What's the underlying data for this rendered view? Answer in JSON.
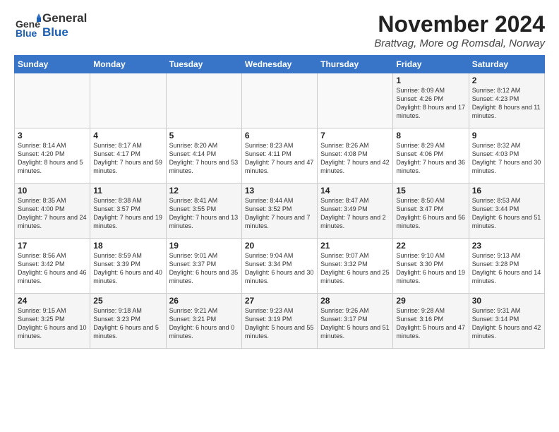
{
  "header": {
    "logo_general": "General",
    "logo_blue": "Blue",
    "title": "November 2024",
    "subtitle": "Brattvag, More og Romsdal, Norway"
  },
  "calendar": {
    "days_of_week": [
      "Sunday",
      "Monday",
      "Tuesday",
      "Wednesday",
      "Thursday",
      "Friday",
      "Saturday"
    ],
    "weeks": [
      [
        {
          "day": "",
          "info": ""
        },
        {
          "day": "",
          "info": ""
        },
        {
          "day": "",
          "info": ""
        },
        {
          "day": "",
          "info": ""
        },
        {
          "day": "",
          "info": ""
        },
        {
          "day": "1",
          "info": "Sunrise: 8:09 AM\nSunset: 4:26 PM\nDaylight: 8 hours and 17 minutes."
        },
        {
          "day": "2",
          "info": "Sunrise: 8:12 AM\nSunset: 4:23 PM\nDaylight: 8 hours and 11 minutes."
        }
      ],
      [
        {
          "day": "3",
          "info": "Sunrise: 8:14 AM\nSunset: 4:20 PM\nDaylight: 8 hours and 5 minutes."
        },
        {
          "day": "4",
          "info": "Sunrise: 8:17 AM\nSunset: 4:17 PM\nDaylight: 7 hours and 59 minutes."
        },
        {
          "day": "5",
          "info": "Sunrise: 8:20 AM\nSunset: 4:14 PM\nDaylight: 7 hours and 53 minutes."
        },
        {
          "day": "6",
          "info": "Sunrise: 8:23 AM\nSunset: 4:11 PM\nDaylight: 7 hours and 47 minutes."
        },
        {
          "day": "7",
          "info": "Sunrise: 8:26 AM\nSunset: 4:08 PM\nDaylight: 7 hours and 42 minutes."
        },
        {
          "day": "8",
          "info": "Sunrise: 8:29 AM\nSunset: 4:06 PM\nDaylight: 7 hours and 36 minutes."
        },
        {
          "day": "9",
          "info": "Sunrise: 8:32 AM\nSunset: 4:03 PM\nDaylight: 7 hours and 30 minutes."
        }
      ],
      [
        {
          "day": "10",
          "info": "Sunrise: 8:35 AM\nSunset: 4:00 PM\nDaylight: 7 hours and 24 minutes."
        },
        {
          "day": "11",
          "info": "Sunrise: 8:38 AM\nSunset: 3:57 PM\nDaylight: 7 hours and 19 minutes."
        },
        {
          "day": "12",
          "info": "Sunrise: 8:41 AM\nSunset: 3:55 PM\nDaylight: 7 hours and 13 minutes."
        },
        {
          "day": "13",
          "info": "Sunrise: 8:44 AM\nSunset: 3:52 PM\nDaylight: 7 hours and 7 minutes."
        },
        {
          "day": "14",
          "info": "Sunrise: 8:47 AM\nSunset: 3:49 PM\nDaylight: 7 hours and 2 minutes."
        },
        {
          "day": "15",
          "info": "Sunrise: 8:50 AM\nSunset: 3:47 PM\nDaylight: 6 hours and 56 minutes."
        },
        {
          "day": "16",
          "info": "Sunrise: 8:53 AM\nSunset: 3:44 PM\nDaylight: 6 hours and 51 minutes."
        }
      ],
      [
        {
          "day": "17",
          "info": "Sunrise: 8:56 AM\nSunset: 3:42 PM\nDaylight: 6 hours and 46 minutes."
        },
        {
          "day": "18",
          "info": "Sunrise: 8:59 AM\nSunset: 3:39 PM\nDaylight: 6 hours and 40 minutes."
        },
        {
          "day": "19",
          "info": "Sunrise: 9:01 AM\nSunset: 3:37 PM\nDaylight: 6 hours and 35 minutes."
        },
        {
          "day": "20",
          "info": "Sunrise: 9:04 AM\nSunset: 3:34 PM\nDaylight: 6 hours and 30 minutes."
        },
        {
          "day": "21",
          "info": "Sunrise: 9:07 AM\nSunset: 3:32 PM\nDaylight: 6 hours and 25 minutes."
        },
        {
          "day": "22",
          "info": "Sunrise: 9:10 AM\nSunset: 3:30 PM\nDaylight: 6 hours and 19 minutes."
        },
        {
          "day": "23",
          "info": "Sunrise: 9:13 AM\nSunset: 3:28 PM\nDaylight: 6 hours and 14 minutes."
        }
      ],
      [
        {
          "day": "24",
          "info": "Sunrise: 9:15 AM\nSunset: 3:25 PM\nDaylight: 6 hours and 10 minutes."
        },
        {
          "day": "25",
          "info": "Sunrise: 9:18 AM\nSunset: 3:23 PM\nDaylight: 6 hours and 5 minutes."
        },
        {
          "day": "26",
          "info": "Sunrise: 9:21 AM\nSunset: 3:21 PM\nDaylight: 6 hours and 0 minutes."
        },
        {
          "day": "27",
          "info": "Sunrise: 9:23 AM\nSunset: 3:19 PM\nDaylight: 5 hours and 55 minutes."
        },
        {
          "day": "28",
          "info": "Sunrise: 9:26 AM\nSunset: 3:17 PM\nDaylight: 5 hours and 51 minutes."
        },
        {
          "day": "29",
          "info": "Sunrise: 9:28 AM\nSunset: 3:16 PM\nDaylight: 5 hours and 47 minutes."
        },
        {
          "day": "30",
          "info": "Sunrise: 9:31 AM\nSunset: 3:14 PM\nDaylight: 5 hours and 42 minutes."
        }
      ]
    ]
  }
}
